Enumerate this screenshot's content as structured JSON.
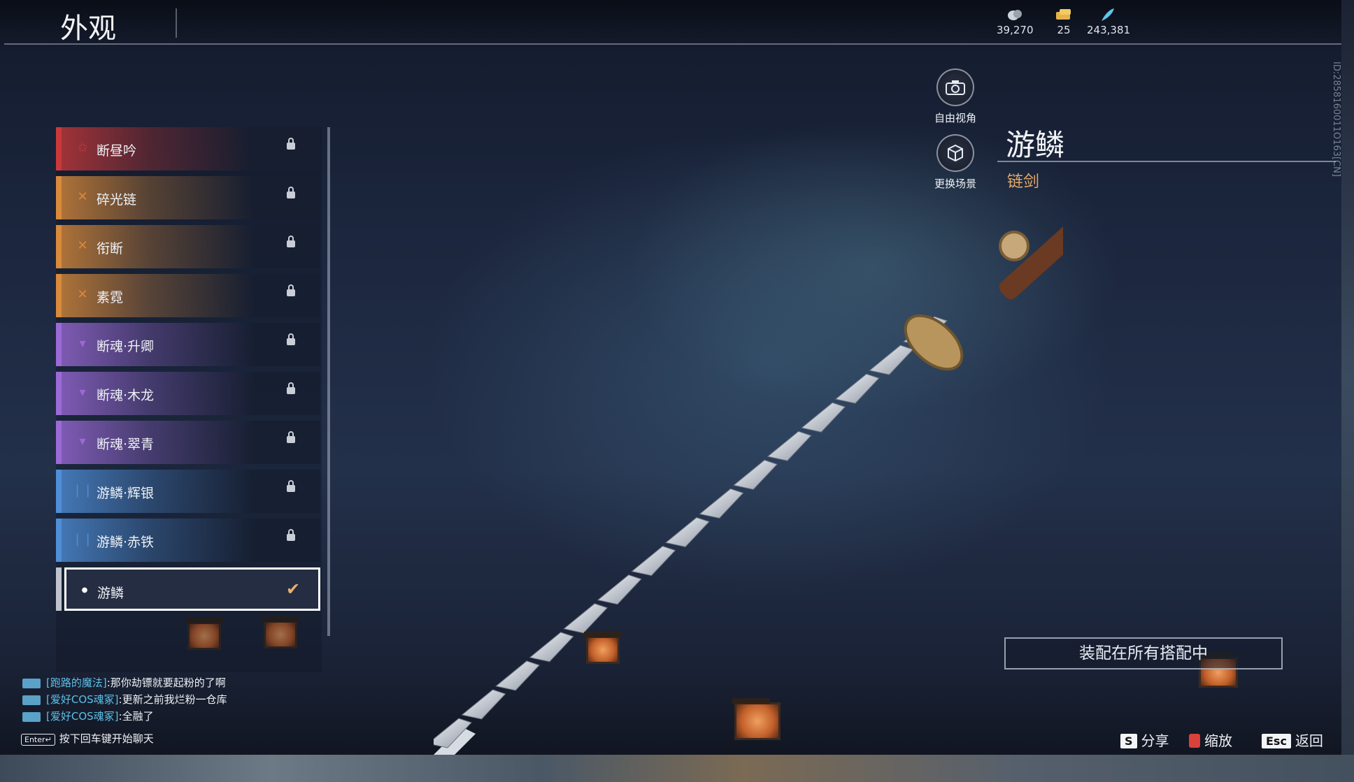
{
  "header": {
    "title": "外观",
    "currencies": [
      {
        "icon": "coin-icon",
        "value": "39,270"
      },
      {
        "icon": "ticket-icon",
        "value": "25"
      },
      {
        "icon": "feather-icon",
        "value": "243,381"
      }
    ]
  },
  "view_buttons": {
    "free_view": {
      "icon": "camera-icon",
      "label": "自由视角"
    },
    "change_scene": {
      "icon": "scene-cube-icon",
      "label": "更换场景"
    }
  },
  "item": {
    "name": "游鳞",
    "type": "链剑",
    "id_text": "ID:2858160011O163[CN]"
  },
  "skins": [
    {
      "label": "断昼吟",
      "rarity": "red",
      "locked": true
    },
    {
      "label": "碎光链",
      "rarity": "orange",
      "locked": true
    },
    {
      "label": "衔断",
      "rarity": "orange",
      "locked": true
    },
    {
      "label": "素霓",
      "rarity": "orange",
      "locked": true
    },
    {
      "label": "断魂·升卿",
      "rarity": "purple",
      "locked": true
    },
    {
      "label": "断魂·木龙",
      "rarity": "purple",
      "locked": true
    },
    {
      "label": "断魂·翠青",
      "rarity": "purple",
      "locked": true
    },
    {
      "label": "游鳞·辉银",
      "rarity": "blue",
      "locked": true
    },
    {
      "label": "游鳞·赤铁",
      "rarity": "blue",
      "locked": true
    },
    {
      "label": "游鳞",
      "rarity": "white",
      "locked": false,
      "selected": true
    }
  ],
  "colors": {
    "red": "#c8393a",
    "orange": "#d98a3a",
    "purple": "#9b6ad6",
    "blue": "#4f8fd8",
    "white": "#bfc4cc",
    "accent": "#e3a86a"
  },
  "equip_button": {
    "label": "装配在所有搭配中"
  },
  "chat": {
    "messages": [
      {
        "user": "[跑路的魔法]",
        "text": ":那你劫镖就要起粉的了啊"
      },
      {
        "user": "[爱好COS魂冢]",
        "text": ":更新之前我烂粉一仓库"
      },
      {
        "user": "[爱好COS魂冢]",
        "text": ":全融了"
      }
    ],
    "enter_key": "Enter↵",
    "enter_hint": "按下回车键开始聊天"
  },
  "hints": [
    {
      "key": "S",
      "label": "分享"
    },
    {
      "key": "",
      "label": "缩放"
    },
    {
      "key": "Esc",
      "label": "返回"
    }
  ]
}
